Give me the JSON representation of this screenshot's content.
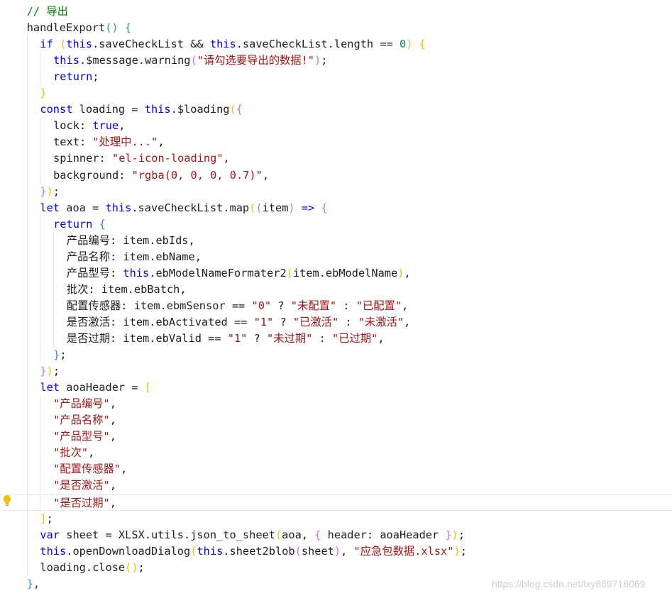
{
  "editor": {
    "colors": {
      "plain": "#1e1e1e",
      "keyword": "#0000ff",
      "string": "#a31515",
      "number": "#098658",
      "comment": "#008000",
      "bracket1": "#f2c200",
      "bracket2": "#d16fd6",
      "bracket3": "#3a8bd8"
    },
    "lines": [
      {
        "indent": 1,
        "tokens": [
          [
            "comment",
            "// 导出"
          ]
        ]
      },
      {
        "indent": 1,
        "tokens": [
          [
            "plain",
            "handleExport"
          ],
          [
            "bracket3",
            "()"
          ],
          [
            "plain",
            " "
          ],
          [
            "bracket3",
            "{"
          ]
        ]
      },
      {
        "indent": 2,
        "tokens": [
          [
            "keyword",
            "if"
          ],
          [
            "plain",
            " "
          ],
          [
            "bracket1",
            "("
          ],
          [
            "keyword",
            "this"
          ],
          [
            "plain",
            ".saveCheckList && "
          ],
          [
            "keyword",
            "this"
          ],
          [
            "plain",
            ".saveCheckList.length == "
          ],
          [
            "number",
            "0"
          ],
          [
            "bracket1",
            ")"
          ],
          [
            "plain",
            " "
          ],
          [
            "bracket1",
            "{"
          ]
        ]
      },
      {
        "indent": 3,
        "tokens": [
          [
            "keyword",
            "this"
          ],
          [
            "plain",
            ".$message.warning"
          ],
          [
            "bracket2",
            "("
          ],
          [
            "string",
            "\"请勾选要导出的数据!\""
          ],
          [
            "bracket2",
            ")"
          ],
          [
            "plain",
            ";"
          ]
        ]
      },
      {
        "indent": 3,
        "tokens": [
          [
            "keyword",
            "return"
          ],
          [
            "plain",
            ";"
          ]
        ]
      },
      {
        "indent": 2,
        "tokens": [
          [
            "bracket1",
            "}"
          ]
        ]
      },
      {
        "indent": 2,
        "tokens": [
          [
            "keyword",
            "const"
          ],
          [
            "plain",
            " loading = "
          ],
          [
            "keyword",
            "this"
          ],
          [
            "plain",
            ".$loading"
          ],
          [
            "bracket1",
            "("
          ],
          [
            "bracket2",
            "{"
          ]
        ]
      },
      {
        "indent": 3,
        "tokens": [
          [
            "plain",
            "lock: "
          ],
          [
            "keyword",
            "true"
          ],
          [
            "plain",
            ","
          ]
        ]
      },
      {
        "indent": 3,
        "tokens": [
          [
            "plain",
            "text: "
          ],
          [
            "string",
            "\"处理中...\""
          ],
          [
            "plain",
            ","
          ]
        ]
      },
      {
        "indent": 3,
        "tokens": [
          [
            "plain",
            "spinner: "
          ],
          [
            "string",
            "\"el-icon-loading\""
          ],
          [
            "plain",
            ","
          ]
        ]
      },
      {
        "indent": 3,
        "tokens": [
          [
            "plain",
            "background: "
          ],
          [
            "string",
            "\"rgba(0, 0, 0, 0.7)\""
          ],
          [
            "plain",
            ","
          ]
        ]
      },
      {
        "indent": 2,
        "tokens": [
          [
            "bracket2",
            "}"
          ],
          [
            "bracket1",
            ")"
          ],
          [
            "plain",
            ";"
          ]
        ]
      },
      {
        "indent": 2,
        "tokens": [
          [
            "keyword",
            "let"
          ],
          [
            "plain",
            " aoa = "
          ],
          [
            "keyword",
            "this"
          ],
          [
            "plain",
            ".saveCheckList.map"
          ],
          [
            "bracket1",
            "("
          ],
          [
            "bracket2",
            "("
          ],
          [
            "plain",
            "item"
          ],
          [
            "bracket2",
            ")"
          ],
          [
            "plain",
            " "
          ],
          [
            "keyword",
            "=>"
          ],
          [
            "plain",
            " "
          ],
          [
            "bracket2",
            "{"
          ]
        ]
      },
      {
        "indent": 3,
        "tokens": [
          [
            "keyword",
            "return"
          ],
          [
            "plain",
            " "
          ],
          [
            "bracket3",
            "{"
          ]
        ]
      },
      {
        "indent": 4,
        "tokens": [
          [
            "plain",
            "产品编号: item.ebIds,"
          ]
        ]
      },
      {
        "indent": 4,
        "tokens": [
          [
            "plain",
            "产品名称: item.ebName,"
          ]
        ]
      },
      {
        "indent": 4,
        "tokens": [
          [
            "plain",
            "产品型号: "
          ],
          [
            "keyword",
            "this"
          ],
          [
            "plain",
            ".ebModelNameFormater2"
          ],
          [
            "bracket1",
            "("
          ],
          [
            "plain",
            "item.ebModelName"
          ],
          [
            "bracket1",
            ")"
          ],
          [
            "plain",
            ","
          ]
        ]
      },
      {
        "indent": 4,
        "tokens": [
          [
            "plain",
            "批次: item.ebBatch,"
          ]
        ]
      },
      {
        "indent": 4,
        "tokens": [
          [
            "plain",
            "配置传感器: item.ebmSensor == "
          ],
          [
            "string",
            "\"0\""
          ],
          [
            "plain",
            " ? "
          ],
          [
            "string",
            "\"未配置\""
          ],
          [
            "plain",
            " : "
          ],
          [
            "string",
            "\"已配置\""
          ],
          [
            "plain",
            ","
          ]
        ]
      },
      {
        "indent": 4,
        "tokens": [
          [
            "plain",
            "是否激活: item.ebActivated == "
          ],
          [
            "string",
            "\"1\""
          ],
          [
            "plain",
            " ? "
          ],
          [
            "string",
            "\"已激活\""
          ],
          [
            "plain",
            " : "
          ],
          [
            "string",
            "\"未激活\""
          ],
          [
            "plain",
            ","
          ]
        ]
      },
      {
        "indent": 4,
        "tokens": [
          [
            "plain",
            "是否过期: item.ebValid == "
          ],
          [
            "string",
            "\"1\""
          ],
          [
            "plain",
            " ? "
          ],
          [
            "string",
            "\"未过期\""
          ],
          [
            "plain",
            " : "
          ],
          [
            "string",
            "\"已过期\""
          ],
          [
            "plain",
            ","
          ]
        ]
      },
      {
        "indent": 3,
        "tokens": [
          [
            "bracket3",
            "}"
          ],
          [
            "plain",
            ";"
          ]
        ]
      },
      {
        "indent": 2,
        "tokens": [
          [
            "bracket2",
            "}"
          ],
          [
            "bracket1",
            ")"
          ],
          [
            "plain",
            ";"
          ]
        ]
      },
      {
        "indent": 2,
        "tokens": [
          [
            "keyword",
            "let"
          ],
          [
            "plain",
            " aoaHeader = "
          ],
          [
            "bracket1",
            "["
          ]
        ]
      },
      {
        "indent": 3,
        "tokens": [
          [
            "string",
            "\"产品编号\""
          ],
          [
            "plain",
            ","
          ]
        ]
      },
      {
        "indent": 3,
        "tokens": [
          [
            "string",
            "\"产品名称\""
          ],
          [
            "plain",
            ","
          ]
        ]
      },
      {
        "indent": 3,
        "tokens": [
          [
            "string",
            "\"产品型号\""
          ],
          [
            "plain",
            ","
          ]
        ]
      },
      {
        "indent": 3,
        "tokens": [
          [
            "string",
            "\"批次\""
          ],
          [
            "plain",
            ","
          ]
        ]
      },
      {
        "indent": 3,
        "tokens": [
          [
            "string",
            "\"配置传感器\""
          ],
          [
            "plain",
            ","
          ]
        ]
      },
      {
        "indent": 3,
        "tokens": [
          [
            "string",
            "\"是否激活\""
          ],
          [
            "plain",
            ","
          ]
        ]
      },
      {
        "indent": 3,
        "tokens": [
          [
            "string",
            "\"是否过期\""
          ],
          [
            "plain",
            ","
          ]
        ],
        "current": true
      },
      {
        "indent": 2,
        "tokens": [
          [
            "bracket1",
            "]"
          ],
          [
            "plain",
            ";"
          ]
        ]
      },
      {
        "indent": 2,
        "tokens": [
          [
            "keyword",
            "var"
          ],
          [
            "plain",
            " sheet = XLSX.utils.json_to_sheet"
          ],
          [
            "bracket1",
            "("
          ],
          [
            "plain",
            "aoa, "
          ],
          [
            "bracket2",
            "{"
          ],
          [
            "plain",
            " header: aoaHeader "
          ],
          [
            "bracket2",
            "}"
          ],
          [
            "bracket1",
            ")"
          ],
          [
            "plain",
            ";"
          ]
        ]
      },
      {
        "indent": 2,
        "tokens": [
          [
            "keyword",
            "this"
          ],
          [
            "plain",
            ".openDownloadDialog"
          ],
          [
            "bracket1",
            "("
          ],
          [
            "keyword",
            "this"
          ],
          [
            "plain",
            ".sheet2blob"
          ],
          [
            "bracket2",
            "("
          ],
          [
            "plain",
            "sheet"
          ],
          [
            "bracket2",
            ")"
          ],
          [
            "plain",
            ", "
          ],
          [
            "string",
            "\"应急包数据.xlsx\""
          ],
          [
            "bracket1",
            ")"
          ],
          [
            "plain",
            ";"
          ]
        ]
      },
      {
        "indent": 2,
        "tokens": [
          [
            "plain",
            "loading.close"
          ],
          [
            "bracket1",
            "()"
          ],
          [
            "plain",
            ";"
          ]
        ]
      },
      {
        "indent": 1,
        "tokens": [
          [
            "bracket3",
            "}"
          ],
          [
            "plain",
            ","
          ]
        ]
      }
    ]
  },
  "watermark": "https://blog.csdn.net/lxy869718069"
}
